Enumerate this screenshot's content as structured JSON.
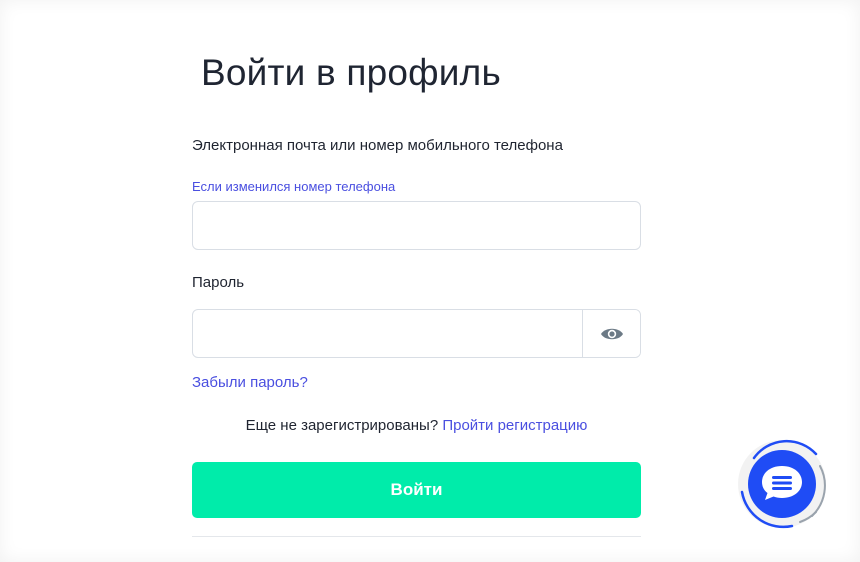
{
  "page": {
    "title": "Войти в профиль"
  },
  "form": {
    "email_label": "Электронная почта или номер мобильного телефона",
    "phone_change_link": "Если изменился номер телефона",
    "email_value": "",
    "password_label": "Пароль",
    "password_value": "",
    "forgot_password_link": "Забыли пароль?",
    "register_prompt": "Еще не зарегистрированы?",
    "register_link": "Пройти регистрацию",
    "submit_label": "Войти"
  },
  "icons": {
    "password_toggle": "eye-icon",
    "chat": "chat-bubble-icon"
  },
  "colors": {
    "accent_link": "#4a4fe0",
    "primary_button": "#00ecaa",
    "chat_button": "#1f4cf5"
  }
}
